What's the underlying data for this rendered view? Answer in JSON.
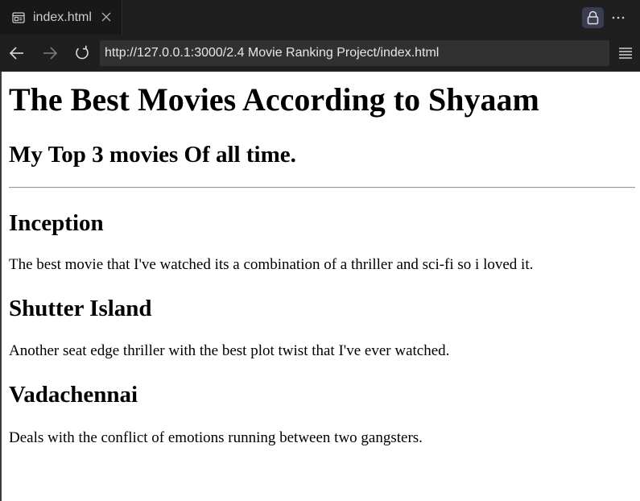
{
  "tab": {
    "title": "index.html",
    "icon": "webpage-icon",
    "close_icon": "close-icon"
  },
  "toolbar": {
    "back_icon": "arrow-left-icon",
    "forward_icon": "arrow-right-icon",
    "reload_icon": "reload-icon",
    "url": "http://127.0.0.1:3000/2.4 Movie Ranking Project/index.html",
    "lock_icon": "lock-icon",
    "more_icon": "more-horizontal-icon",
    "menu_icon": "menu-icon"
  },
  "page": {
    "heading": "The Best Movies According to Shyaam",
    "subheading": "My Top 3 movies Of all time.",
    "movies": [
      {
        "title": "Inception",
        "description": "The best movie that I've watched its a combination of a thriller and sci-fi so i loved it."
      },
      {
        "title": "Shutter Island",
        "description": "Another seat edge thriller with the best plot twist that I've ever watched."
      },
      {
        "title": "Vadachennai",
        "description": "Deals with the conflict of emotions running between two gangsters."
      }
    ]
  },
  "colors": {
    "chrome_bg": "#1f1f1f",
    "url_bar_bg": "#313131",
    "lock_button_bg": "#3a3d50",
    "page_bg": "#ffffff"
  }
}
